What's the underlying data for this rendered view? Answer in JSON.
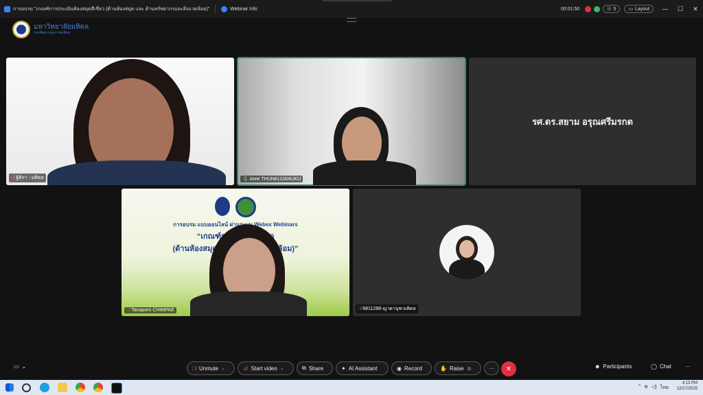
{
  "titlebar": {
    "title": "การอบรม \"เกณฑ์การประเมินห้องสมุดสีเขียว (ด้านห้องสมุด และ ด้านทรัพยากรและสิ่งแวดล้อม)\"",
    "webinar_info": "Webinar Info",
    "timer": "00:01:50",
    "panelists_count": "5",
    "layout_label": "Layout",
    "minimize": "—",
    "maximize": "☐",
    "close": "✕"
  },
  "logo": {
    "line1": "มหาวิทยาลัยมหิดล",
    "line2": "กองพัฒนาคุณภาพมหิดล"
  },
  "participants": [
    {
      "name": "ฐิติรา - มหิดล",
      "mic": "muted"
    },
    {
      "name": "Aree THUNKIJJANUKIJ",
      "mic": "on"
    },
    {
      "name": "รศ.ดร.สยาม อรุณศรีมรกต",
      "mic": "none"
    },
    {
      "name": "Tanaporn CHIMPAE",
      "mic": "muted"
    },
    {
      "name": "6811288-ญาดานุช-มหิดล",
      "mic": "muted"
    }
  ],
  "slide": {
    "line1": "การอบรม แบบออนไลน์ ผ่านระบบ Webex Webinars",
    "line2": "“เกณฑ์การประ...สีเขียว",
    "line3": "(ด้านห้องสมุด และ ด้าน...ลิ่งแวดล้อม)”"
  },
  "controls": {
    "unmute": "Unmute",
    "start_video": "Start video",
    "share": "Share",
    "ai_assistant": "AI Assistant",
    "record": "Record",
    "raise": "Raise",
    "more": "···",
    "participants": "Participants",
    "chat": "Chat"
  },
  "taskbar": {
    "lang": "ไทย",
    "time": "4:13 PM",
    "date": "12/17/2025"
  },
  "colors": {
    "accent": "#2e8b73",
    "end_call": "#e0303d",
    "muted": "#ff6b6b",
    "brand": "#4a7fd8"
  }
}
